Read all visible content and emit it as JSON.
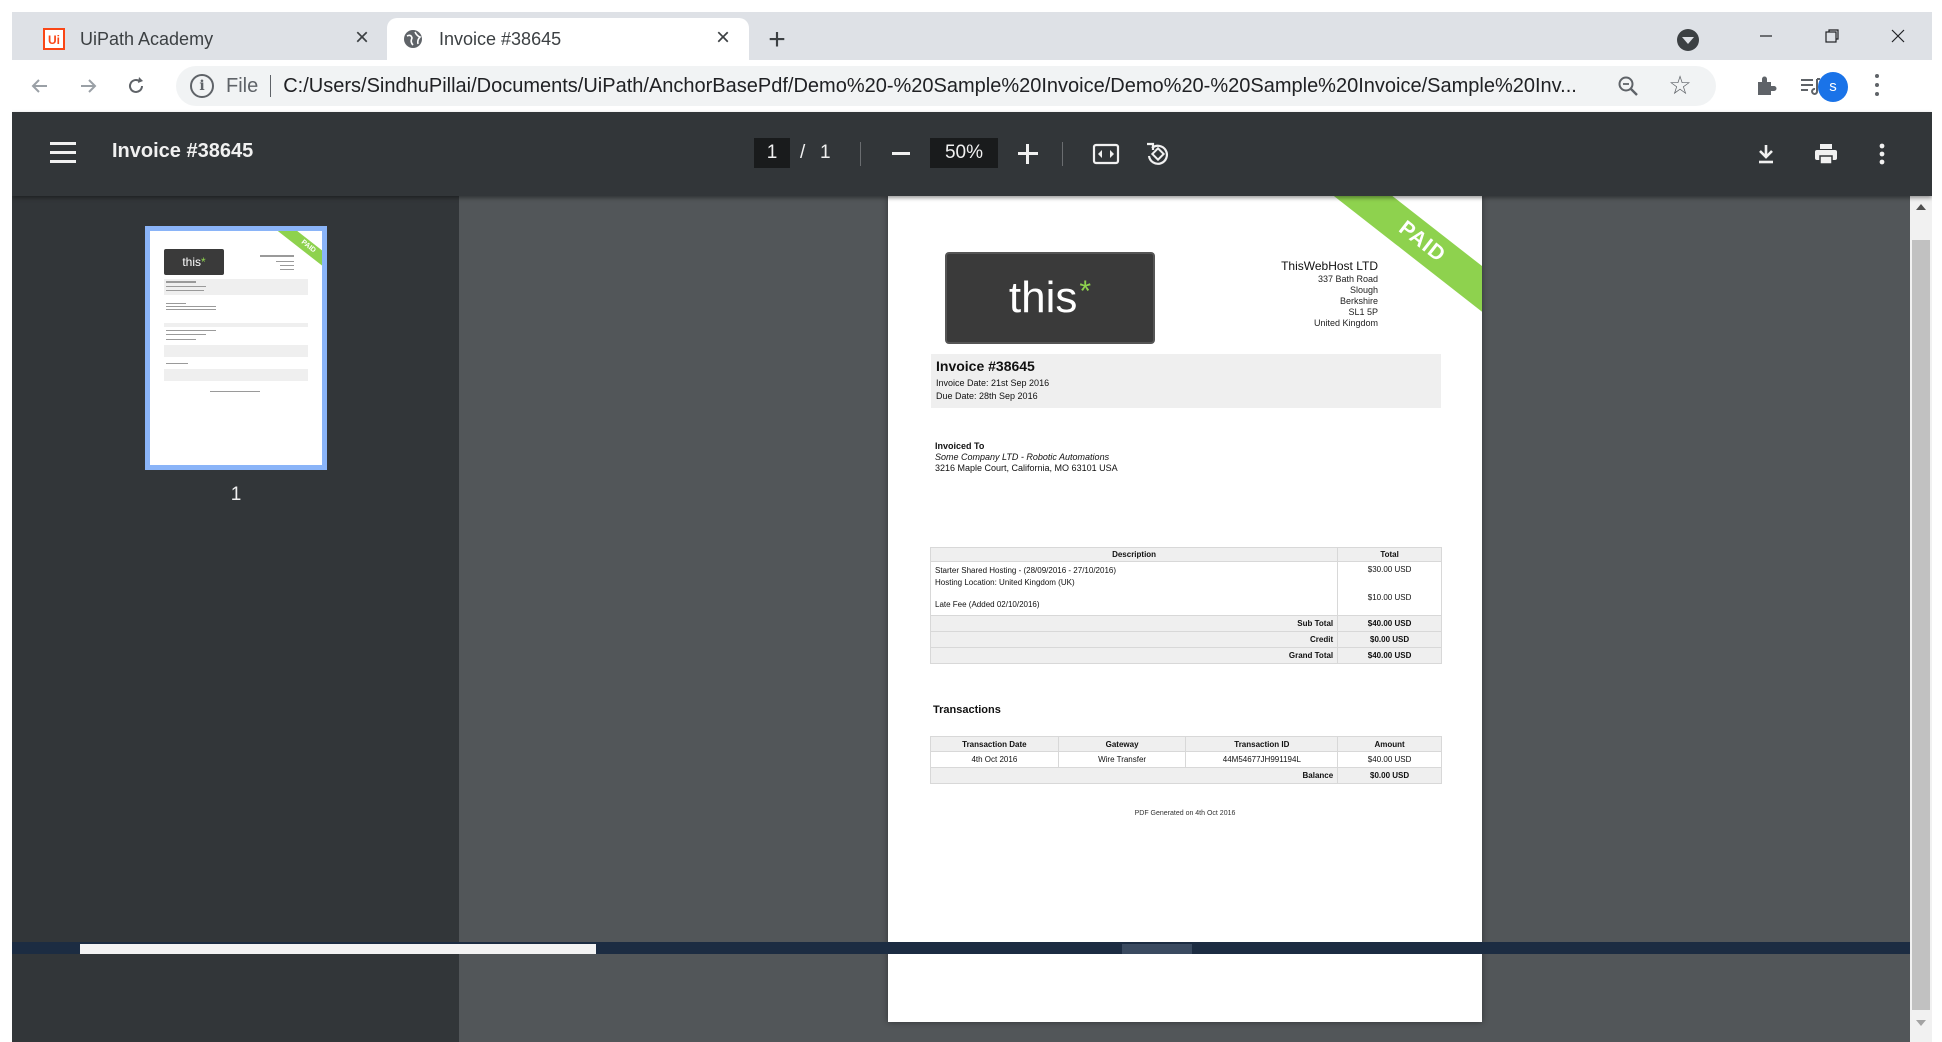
{
  "browser": {
    "tabs": [
      {
        "title": "UiPath Academy",
        "active": false,
        "favicon": "Ui"
      },
      {
        "title": "Invoice #38645",
        "active": true
      }
    ],
    "address": {
      "scheme": "File",
      "url": "C:/Users/SindhuPillai/Documents/UiPath/AnchorBasePdf/Demo%20-%20Sample%20Invoice/Demo%20-%20Sample%20Invoice/Sample%20Inv..."
    },
    "profile_initial": "s",
    "colors": {
      "accent": "#1a73e8",
      "uipath": "#fa4616"
    }
  },
  "pdf_viewer": {
    "title": "Invoice #38645",
    "page_current": "1",
    "page_separator": "/",
    "page_total": "1",
    "zoom": "50%",
    "thumbnail_label": "1"
  },
  "invoice": {
    "stamp": "PAID",
    "logo_text": "this",
    "logo_mark": "*",
    "company": {
      "name": "ThisWebHost LTD",
      "address": [
        "337 Bath Road",
        "Slough",
        "Berkshire",
        "SL1 5P",
        "United Kingdom"
      ]
    },
    "number": "Invoice #38645",
    "invoice_date": "Invoice Date: 21st Sep 2016",
    "due_date": "Due Date: 28th Sep 2016",
    "invoiced_to_label": "Invoiced To",
    "client_name": "Some Company LTD - Robotic Automations",
    "client_address": "3216 Maple Court,   California, MO 63101 USA",
    "items_header": {
      "description": "Description",
      "total": "Total"
    },
    "items": [
      {
        "description": "Starter Shared Hosting - (28/09/2016 - 27/10/2016)",
        "total": "$30.00 USD"
      },
      {
        "description": "Hosting Location: United Kingdom (UK)",
        "total": ""
      },
      {
        "description": "Late Fee (Added 02/10/2016)",
        "total": "$10.00 USD"
      }
    ],
    "summary": [
      {
        "label": "Sub Total",
        "value": "$40.00 USD"
      },
      {
        "label": "Credit",
        "value": "$0.00 USD"
      },
      {
        "label": "Grand Total",
        "value": "$40.00 USD"
      }
    ],
    "transactions_title": "Transactions",
    "transactions_header": {
      "date": "Transaction Date",
      "gateway": "Gateway",
      "id": "Transaction ID",
      "amount": "Amount"
    },
    "transactions": [
      {
        "date": "4th Oct 2016",
        "gateway": "Wire Transfer",
        "id": "44M54677JH991194L",
        "amount": "$40.00 USD"
      }
    ],
    "balance_label": "Balance",
    "balance_value": "$0.00 USD",
    "generated": "PDF Generated on 4th Oct 2016",
    "colors": {
      "paid_green": "#8ed24e",
      "logo_bg": "#3a3a3a"
    }
  }
}
